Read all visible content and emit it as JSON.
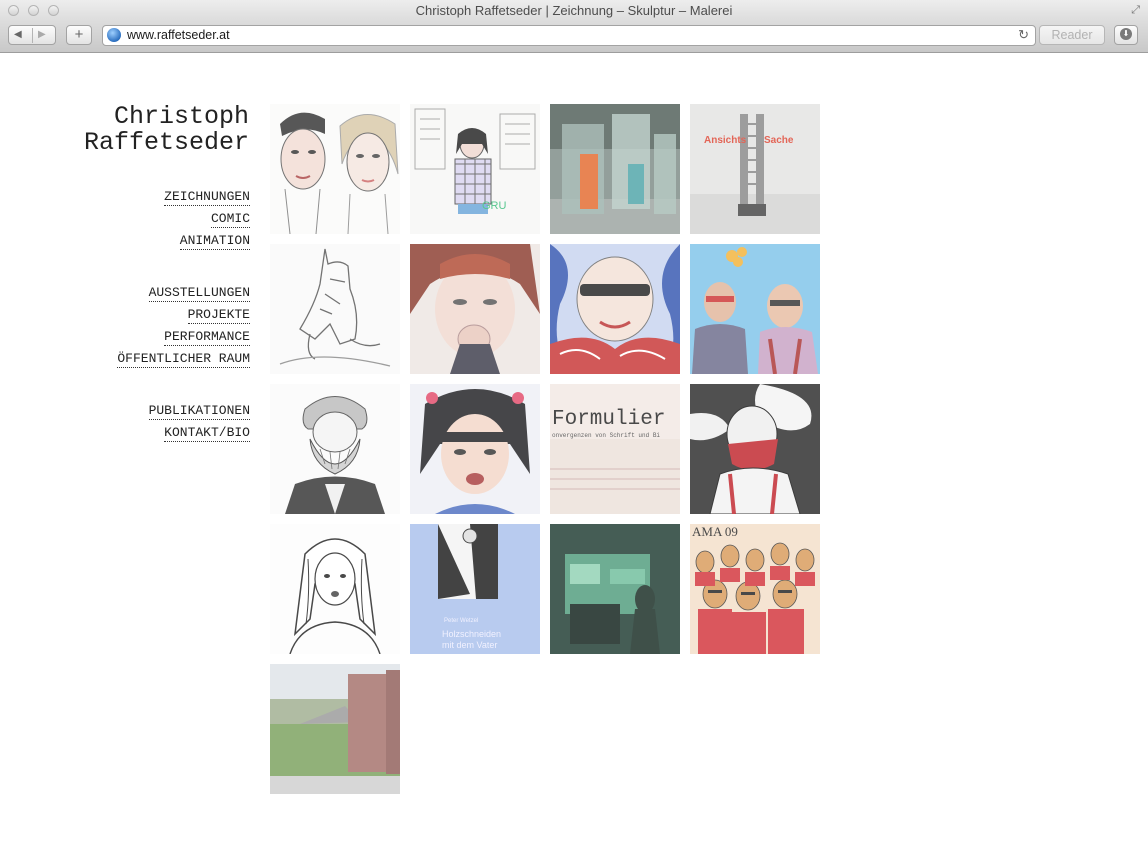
{
  "browser": {
    "window_title": "Christoph Raffetseder | Zeichnung – Skulptur – Malerei",
    "url": "www.raffetseder.at",
    "reader_label": "Reader",
    "back_icon": "◀",
    "forward_icon": "▶",
    "add_icon": "+",
    "reload_icon": "↻"
  },
  "site": {
    "title_line1": "Christoph",
    "title_line2": "Raffetseder"
  },
  "nav": {
    "group1": [
      "ZEICHNUNGEN",
      "COMIC",
      "ANIMATION"
    ],
    "group2": [
      "AUSSTELLUNGEN",
      "PROJEKTE",
      "PERFORMANCE",
      "ÖFFENTLICHER RAUM"
    ],
    "group3": [
      "PUBLIKATIONEN",
      "KONTAKT/BIO"
    ]
  },
  "gallery": [
    {
      "name": "thumb-two-portraits-drawing"
    },
    {
      "name": "thumb-girl-city-drawing",
      "text": "GRU"
    },
    {
      "name": "thumb-glass-sculpture-photo"
    },
    {
      "name": "thumb-ansichts-sache-book",
      "text1": "Ansichts",
      "text2": "Sache"
    },
    {
      "name": "thumb-figure-sketch"
    },
    {
      "name": "thumb-woman-yawning-painting"
    },
    {
      "name": "thumb-sunglasses-face-painting"
    },
    {
      "name": "thumb-two-men-sunglasses-photo"
    },
    {
      "name": "thumb-bearded-man-drawing"
    },
    {
      "name": "thumb-girl-portrait-painting"
    },
    {
      "name": "thumb-formuliert-book",
      "text1": "Formulier",
      "text2": "onvergenzen von Schrift und Bi"
    },
    {
      "name": "thumb-masked-man-drawing"
    },
    {
      "name": "thumb-woman-lineart-drawing"
    },
    {
      "name": "thumb-holzschneiden-book",
      "text0": "Peter Wetzel",
      "text1": "Holzschneiden",
      "text2": "mit dem Vater"
    },
    {
      "name": "thumb-dark-room-photo"
    },
    {
      "name": "thumb-crowd-painting",
      "text": "AMA 09"
    },
    {
      "name": "thumb-landscape-sculpture-photo"
    }
  ],
  "colors": {
    "text": "#222222",
    "chrome": "#dcdcdc"
  }
}
